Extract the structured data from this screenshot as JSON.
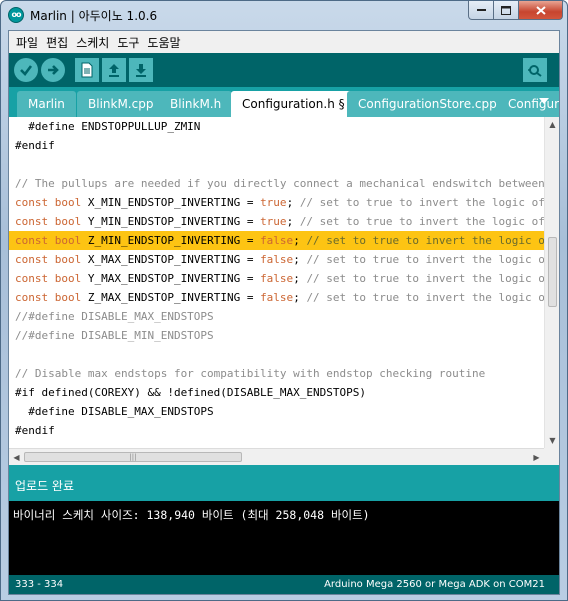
{
  "window": {
    "title": "Marlin | 아두이노 1.0.6",
    "app_icon_text": "oo"
  },
  "menu": [
    "파일",
    "편집",
    "스케치",
    "도구",
    "도움말"
  ],
  "toolbar": {
    "verify_icon": "check-icon",
    "upload_icon": "right-arrow-icon",
    "new_icon": "new-file-icon",
    "open_icon": "open-up-arrow-icon",
    "save_icon": "save-down-arrow-icon",
    "serial_icon": "serial-monitor-icon"
  },
  "tabs": [
    {
      "label": "Marlin",
      "active": false
    },
    {
      "label": "BlinkM.cpp",
      "active": false
    },
    {
      "label": "BlinkM.h",
      "active": false
    },
    {
      "label": "Configuration.h §",
      "active": true
    },
    {
      "label": "ConfigurationStore.cpp",
      "active": false
    },
    {
      "label": "Configura",
      "active": false
    }
  ],
  "code_lines": [
    "  #define ENDSTOPPULLUP_ZMIN",
    "#endif",
    "",
    "// The pullups are needed if you directly connect a mechanical endswitch between the sig",
    "const bool X_MIN_ENDSTOP_INVERTING = true; // set to true to invert the logic of the end",
    "const bool Y_MIN_ENDSTOP_INVERTING = true; // set to true to invert the logic of the end",
    "const bool Z_MIN_ENDSTOP_INVERTING = false; // set to true to invert the logic of the en",
    "const bool X_MAX_ENDSTOP_INVERTING = false; // set to true to invert the logic of the en",
    "const bool Y_MAX_ENDSTOP_INVERTING = false; // set to true to invert the logic of the en",
    "const bool Z_MAX_ENDSTOP_INVERTING = false; // set to true to invert the logic of the en",
    "//#define DISABLE_MAX_ENDSTOPS",
    "//#define DISABLE_MIN_ENDSTOPS",
    "",
    "// Disable max endstops for compatibility with endstop checking routine",
    "#if defined(COREXY) && !defined(DISABLE_MAX_ENDSTOPS)",
    "  #define DISABLE_MAX_ENDSTOPS",
    "#endif"
  ],
  "highlighted_line": 6,
  "status": {
    "message": "업로드 완료"
  },
  "console": {
    "output": "바이너리 스케치 사이즈: 138,940 바이트 (최대 258,048 바이트)"
  },
  "footer": {
    "line_range": "333 - 334",
    "board": "Arduino Mega 2560 or Mega ADK on COM21"
  },
  "colors": {
    "toolbar_bg": "#006468",
    "tab_strip_bg": "#17a1a5",
    "tab_inactive": "#4db7bb",
    "highlight": "#fdc413",
    "keyword": "#cc6633",
    "comment": "#8c8c8c"
  }
}
